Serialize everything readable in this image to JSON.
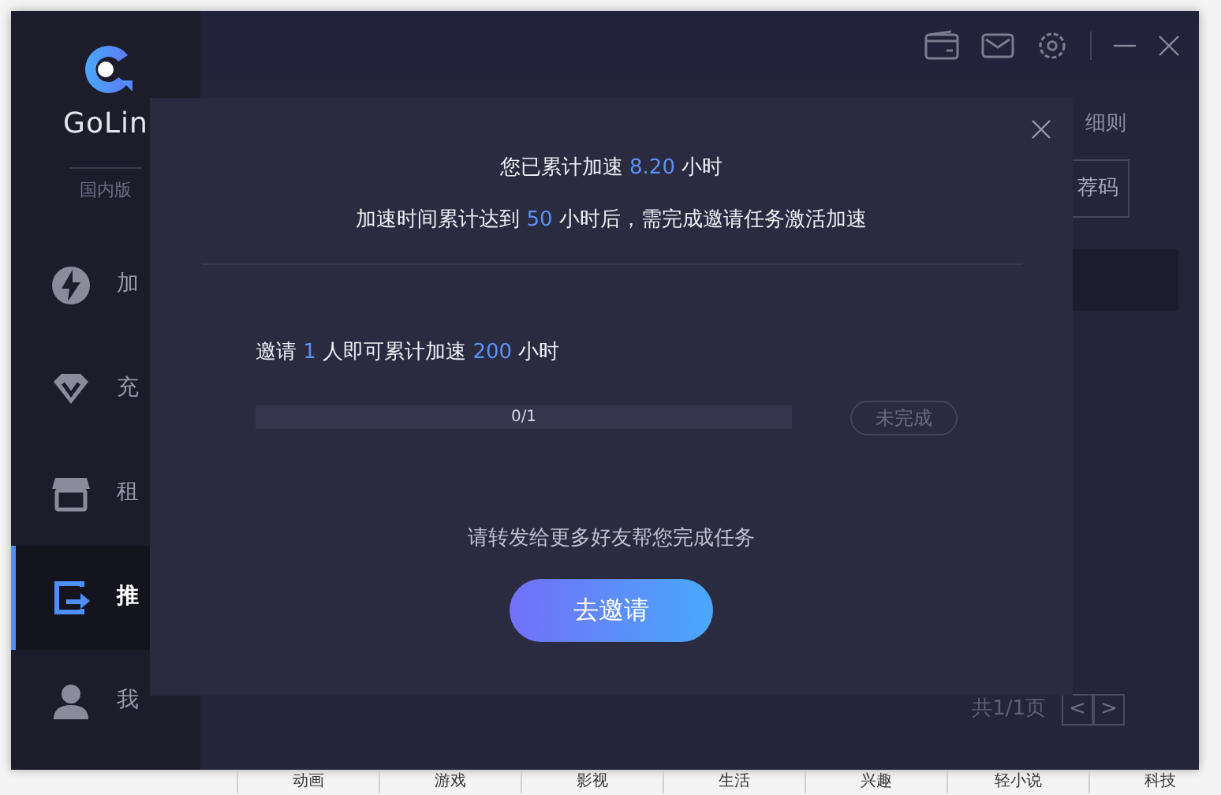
{
  "app": {
    "logo_text": "GoLin",
    "edition": "国内版"
  },
  "sidebar": {
    "items": [
      {
        "label": "加",
        "selected": false
      },
      {
        "label": "充",
        "selected": false
      },
      {
        "label": "租",
        "selected": false
      },
      {
        "label": "推",
        "selected": true
      },
      {
        "label": "我",
        "selected": false
      }
    ]
  },
  "main": {
    "rules_link": "细则",
    "code_button": "荐码",
    "pagination": {
      "text": "共1/1页",
      "prev": "<",
      "next": ">"
    }
  },
  "dialog": {
    "summary": [
      {
        "text": "您已累计加速 ",
        "highlight": false
      },
      {
        "text": "8.20",
        "highlight": true
      },
      {
        "text": " 小时",
        "highlight": false
      }
    ],
    "notice": [
      {
        "text": "加速时间累计达到 ",
        "highlight": false
      },
      {
        "text": "50",
        "highlight": true
      },
      {
        "text": " 小时后，需完成邀请任务激活加速",
        "highlight": false
      }
    ],
    "task": {
      "description": [
        {
          "text": "邀请 ",
          "highlight": false
        },
        {
          "text": "1",
          "highlight": true
        },
        {
          "text": " 人即可累计加速 ",
          "highlight": false
        },
        {
          "text": "200",
          "highlight": true
        },
        {
          "text": " 小时",
          "highlight": false
        }
      ],
      "level": 0,
      "progress_text": "0/1",
      "status": "未完成",
      "completed": false
    },
    "hint": "请转发给更多好友帮您完成任务",
    "invite_button": "去邀请"
  },
  "background_tabs": [
    "动画",
    "游戏",
    "影视",
    "生活",
    "兴趣",
    "轻小说",
    "科技"
  ]
}
